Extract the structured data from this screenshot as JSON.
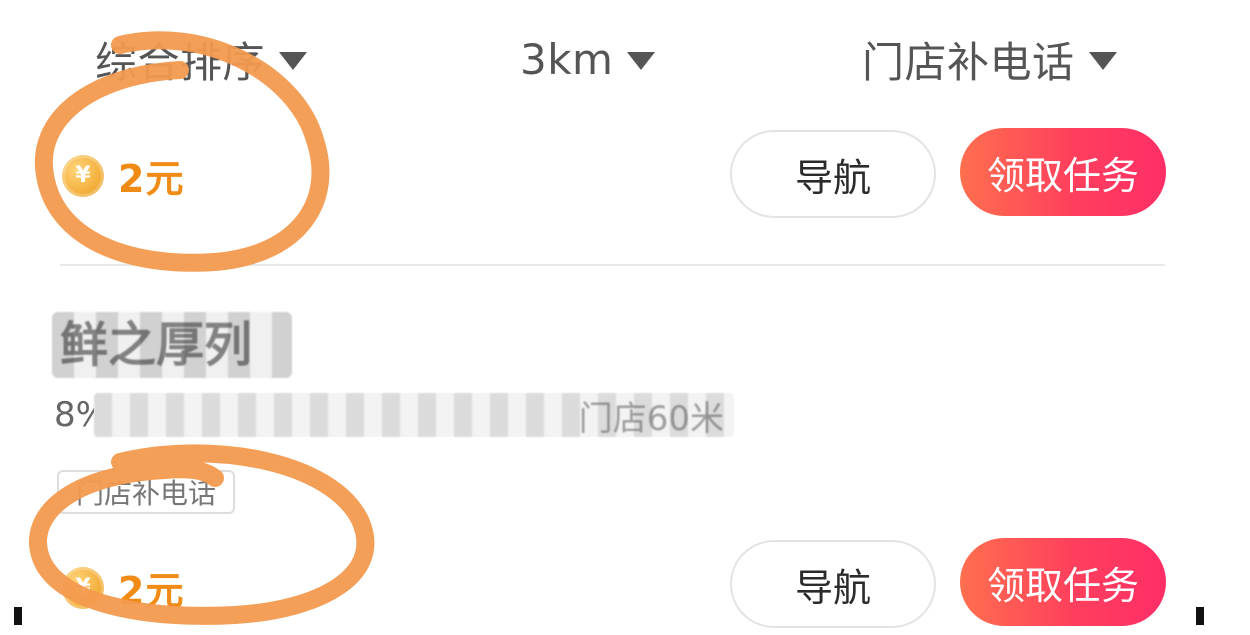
{
  "filters": {
    "sort": {
      "label": "综合排序"
    },
    "distance": {
      "label": "3km"
    },
    "task_type": {
      "label": "门店补电话"
    }
  },
  "cards": [
    {
      "reward": {
        "currency_symbol": "¥",
        "amount": "2元"
      },
      "actions": {
        "navigate": "导航",
        "claim": "领取任务"
      }
    },
    {
      "store": {
        "name": "鲜之厚列",
        "meta_prefix": "8%",
        "meta_suffix": "门店60米"
      },
      "tag": "门店补电话",
      "reward": {
        "currency_symbol": "¥",
        "amount": "2元"
      },
      "actions": {
        "navigate": "导航",
        "claim": "领取任务"
      }
    }
  ],
  "colors": {
    "accent_orange": "#f08b15",
    "claim_gradient_start": "#ff6f4e",
    "claim_gradient_end": "#ff2e67",
    "annotation": "#f39a4f"
  },
  "icons": {
    "filter_dropdown": "triangle-down-icon",
    "reward": "yuan-coin-icon"
  }
}
